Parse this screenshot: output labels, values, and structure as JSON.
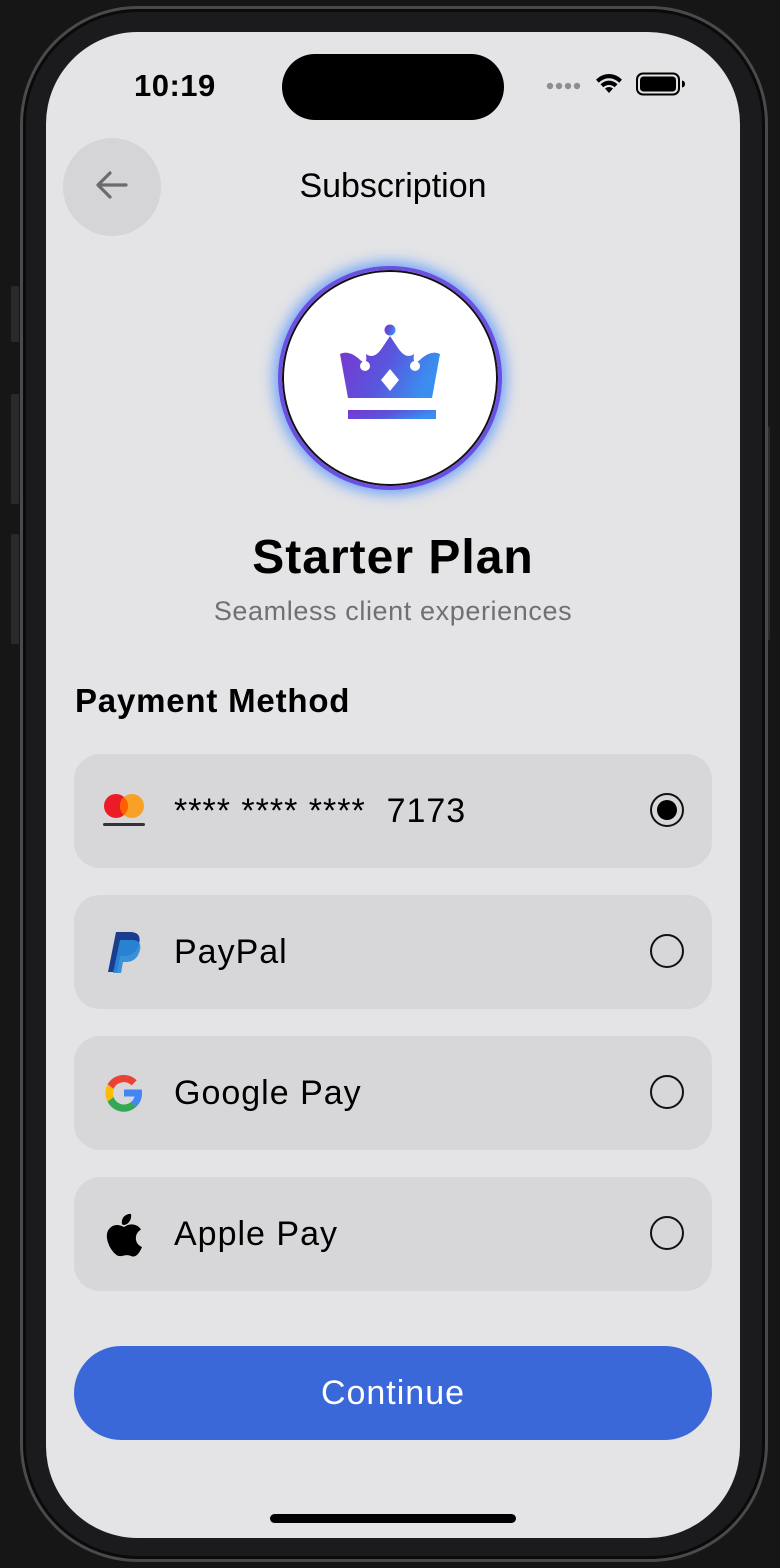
{
  "status_bar": {
    "time": "10:19"
  },
  "header": {
    "title": "Subscription",
    "back_icon": "arrow-left-icon"
  },
  "plan": {
    "name": "Starter Plan",
    "tagline": "Seamless client experiences",
    "icon": "crown-icon"
  },
  "payment": {
    "section_title": "Payment Method",
    "selected": 0,
    "options": [
      {
        "label": "**** **** ****  7173",
        "icon": "mastercard-icon",
        "selected": true
      },
      {
        "label": "PayPal",
        "icon": "paypal-icon",
        "selected": false
      },
      {
        "label": "Google Pay",
        "icon": "google-icon",
        "selected": false
      },
      {
        "label": "Apple Pay",
        "icon": "apple-icon",
        "selected": false
      }
    ]
  },
  "actions": {
    "continue_label": "Continue"
  },
  "colors": {
    "accent": "#3a68d8",
    "screen_bg": "#e4e4e6",
    "row_bg": "#d7d7d9"
  }
}
